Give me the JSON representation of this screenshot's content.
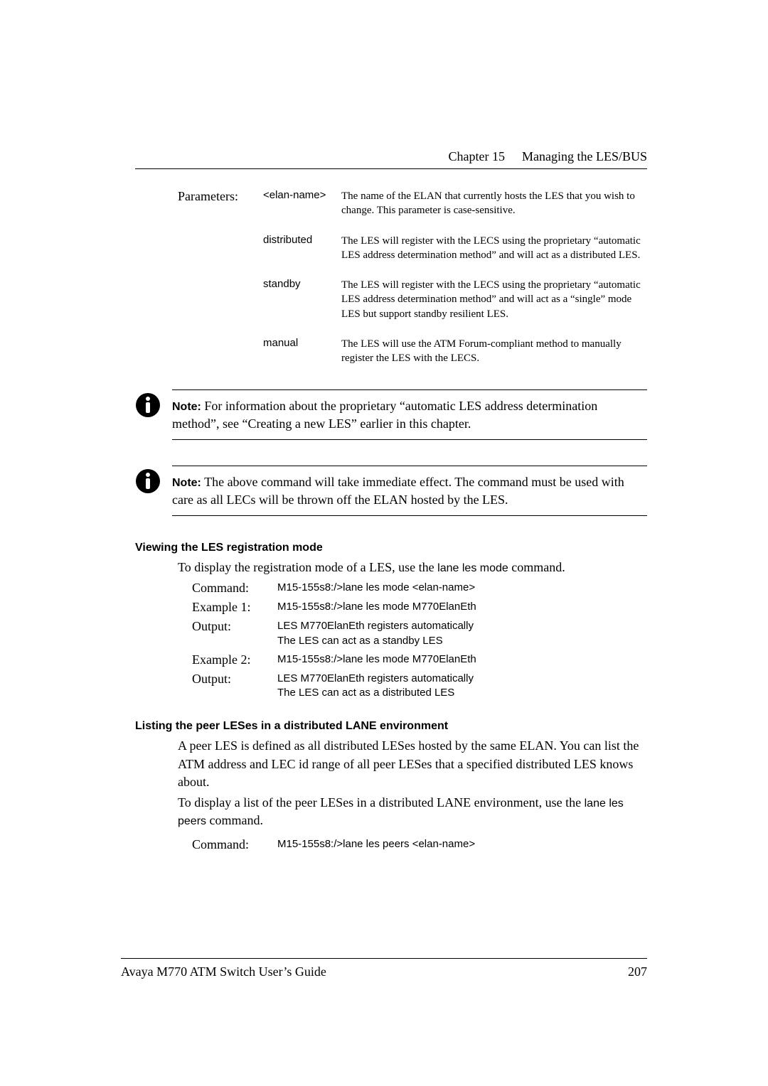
{
  "header": {
    "chapter": "Chapter 15",
    "title": "Managing the LES/BUS"
  },
  "paramsLabel": "Parameters:",
  "params": [
    {
      "key": "<elan-name>",
      "desc": "The name of the ELAN that currently hosts the LES that you wish to change. This parameter is case-sensitive."
    },
    {
      "key": "distributed",
      "desc": "The LES will register with the LECS using the proprietary “automatic LES address determination method” and will act as a distributed LES."
    },
    {
      "key": "standby",
      "desc": "The LES will register with the LECS using the proprietary “automatic LES address determination method” and will act as a “single” mode LES but support standby resilient LES."
    },
    {
      "key": "manual",
      "desc": "The LES will use the ATM Forum-compliant method to manually register the LES with the LECS."
    }
  ],
  "notes": [
    {
      "label": "Note:",
      "text": "For information about the proprietary “automatic LES address determination method”, see “Creating a new LES” earlier in this chapter."
    },
    {
      "label": "Note:",
      "text": "The above command will take immediate effect. The command must be used with care as all LECs will be thrown off the ELAN hosted by the LES."
    }
  ],
  "section1": {
    "heading": "Viewing the LES registration mode",
    "intro_pre": "To display the registration mode of a LES, use the ",
    "intro_cmd": "lane les mode",
    "intro_post": " command.",
    "rows": [
      {
        "label": "Command:",
        "val": "M15-155s8:/>lane les mode <elan-name>"
      },
      {
        "label": "Example 1:",
        "val": "M15-155s8:/>lane les mode M770ElanEth"
      },
      {
        "label": "Output:",
        "val": "LES M770ElanEth registers automatically\nThe LES can act as a standby LES"
      },
      {
        "label": "Example 2:",
        "val": "M15-155s8:/>lane les mode M770ElanEth"
      },
      {
        "label": "Output:",
        "val": "LES M770ElanEth registers automatically\nThe LES can act as a distributed LES"
      }
    ]
  },
  "section2": {
    "heading": "Listing the peer LESes in a distributed LANE environment",
    "para1": "A peer LES is defined as all distributed LESes hosted by the same ELAN. You can list the ATM address and LEC id range of all peer LESes that a specified distributed LES knows about.",
    "para2_pre": "To display a list of the peer LESes in a distributed LANE environment, use the ",
    "para2_cmd": "lane les peers",
    "para2_post": " command.",
    "rows": [
      {
        "label": "Command:",
        "val": "M15-155s8:/>lane les peers <elan-name>"
      }
    ]
  },
  "footer": {
    "left": "Avaya M770 ATM Switch User’s Guide",
    "right": "207"
  }
}
